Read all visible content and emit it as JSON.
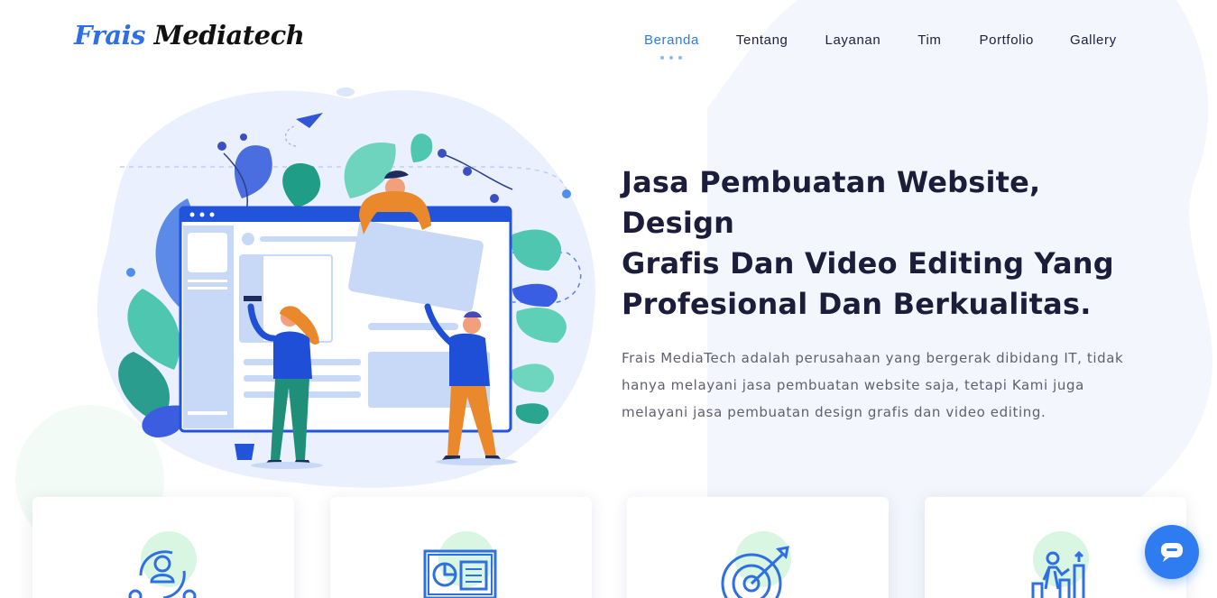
{
  "brand": {
    "logo_part1": "Frais",
    "logo_part2": "Mediatech"
  },
  "nav": {
    "items": [
      {
        "label": "Beranda",
        "active": true
      },
      {
        "label": "Tentang",
        "active": false
      },
      {
        "label": "Layanan",
        "active": false
      },
      {
        "label": "Tim",
        "active": false
      },
      {
        "label": "Portfolio",
        "active": false
      },
      {
        "label": "Gallery",
        "active": false
      }
    ]
  },
  "hero": {
    "title_line1": "Jasa Pembuatan Website, Design",
    "title_line2": "Grafis Dan Video Editing Yang",
    "title_line3": "Profesional Dan Berkualitas.",
    "description": "Frais MediaTech adalah perusahaan yang bergerak dibidang IT, tidak hanya melayani jasa pembuatan website saja, tetapi Kami juga melayani jasa pembuatan design grafis dan video editing."
  },
  "cards": [
    {
      "icon": "user-cycle-icon"
    },
    {
      "icon": "presentation-icon"
    },
    {
      "icon": "target-icon"
    },
    {
      "icon": "growth-chart-icon"
    }
  ],
  "chat": {
    "icon": "chat-bubble-icon"
  },
  "colors": {
    "primary": "#2f7ae5",
    "dark": "#1c1d3b",
    "text_muted": "#606070",
    "blob": "#f3f6fe",
    "accent_green": "#d9f6e2"
  }
}
